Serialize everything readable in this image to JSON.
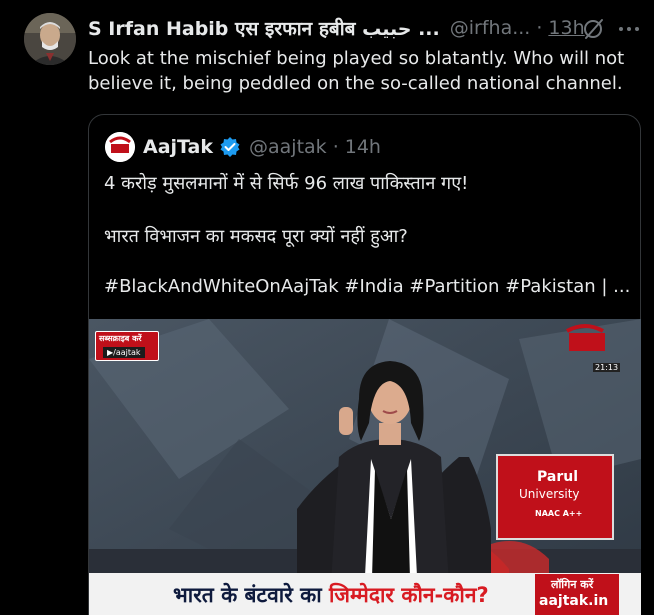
{
  "tweet": {
    "author_name": "S Irfan Habib एस इरफान हबीब حبیب ...",
    "handle": "@irfha...",
    "separator": "·",
    "time": "13h",
    "text": "Look at the mischief being played so blatantly. Who will not believe it, being peddled on the so-called national channel."
  },
  "quote": {
    "author_name": "AajTak",
    "handle": "@aajtak",
    "separator": "·",
    "time": "14h",
    "lines": [
      "4 करोड़ मुसलमानों में से सिर्फ 96 लाख पाकिस्तान गए!",
      "भारत विभाजन का मकसद पूरा क्यों नहीं हुआ?",
      "#BlackAndWhiteOnAajTak #India #Partition #Pakistan | ..."
    ],
    "media": {
      "badge_top": "सब्सक्राइब करें",
      "badge_bottom": "▶/aajtak",
      "banner_part1": "भारत के बंटवारे का ",
      "banner_part2": "जिम्मेदार कौन-कौन?",
      "login_line1": "लॉगिन करें",
      "login_line2": "aajtak.in",
      "parul_title": "Parul",
      "parul_sub": "University",
      "parul_naac": "NAAC A++",
      "clock": "21:13"
    }
  },
  "colors": {
    "background": "#000000",
    "text_primary": "#e7e9ea",
    "text_secondary": "#71767b",
    "border": "#333639",
    "verified": "#1d9bf0",
    "aajtak_red": "#c0101a"
  },
  "icons": {
    "grok": "grok-icon",
    "more": "more-icon",
    "verified": "verified-badge-icon"
  }
}
